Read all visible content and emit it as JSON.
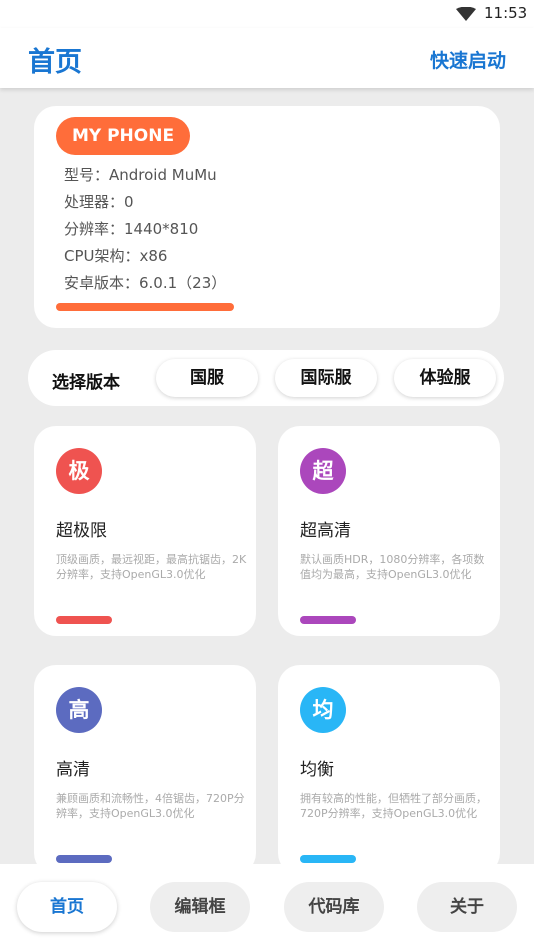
{
  "status_bar": {
    "time": "11:53",
    "wifi_icon": "wifi-icon"
  },
  "app_bar": {
    "title": "首页",
    "action": "快速启动"
  },
  "phone_card": {
    "badge": "MY PHONE",
    "specs": [
      "型号：Android MuMu",
      "处理器：0",
      "分辨率：1440*810",
      "CPU架构：x86",
      "安卓版本：6.0.1（23）"
    ],
    "accent": "#ff6d3a"
  },
  "version_select": {
    "label": "选择版本",
    "options": [
      "国服",
      "国际服",
      "体验服"
    ]
  },
  "modes": [
    {
      "icon_char": "极",
      "name": "超极限",
      "desc": "顶级画质，最远视距，最高抗锯齿，2K分辨率，支持OpenGL3.0优化",
      "color": "#ef5350"
    },
    {
      "icon_char": "超",
      "name": "超高清",
      "desc": "默认画质HDR，1080分辨率，各项数值均为最高，支持OpenGL3.0优化",
      "color": "#ab47bc"
    },
    {
      "icon_char": "高",
      "name": "高清",
      "desc": "兼顾画质和流畅性，4倍锯齿，720P分辨率，支持OpenGL3.0优化",
      "color": "#5c6bc0"
    },
    {
      "icon_char": "均",
      "name": "均衡",
      "desc": "拥有较高的性能，但牺牲了部分画质，720P分辨率，支持OpenGL3.0优化",
      "color": "#29b6f6"
    }
  ],
  "bottom_nav": {
    "items": [
      "首页",
      "编辑框",
      "代码库",
      "关于"
    ],
    "active_index": 0
  },
  "colors": {
    "primary": "#1976d2",
    "background": "#ececec"
  }
}
